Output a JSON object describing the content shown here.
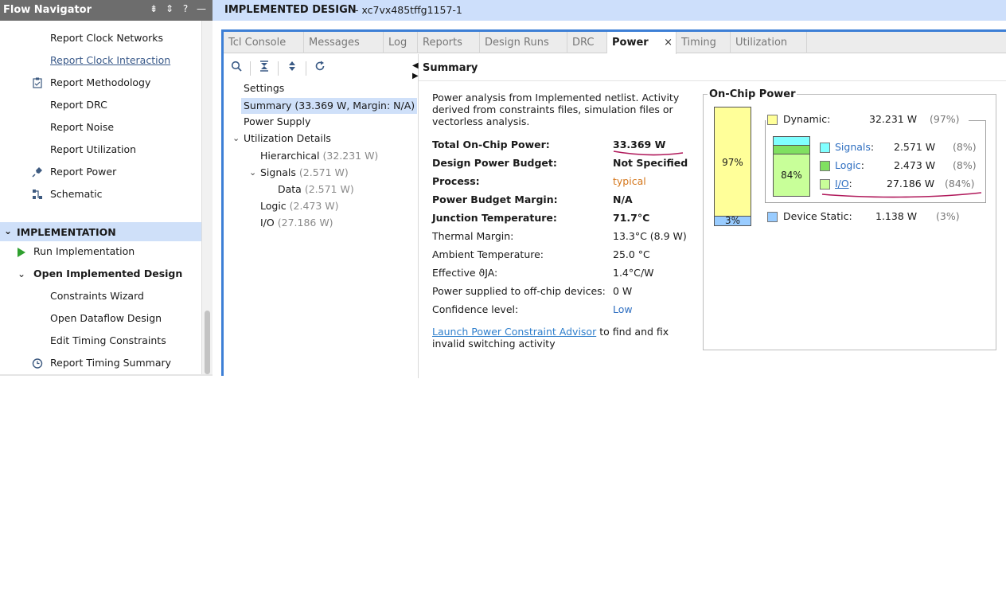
{
  "colors": {
    "header_blue": "#cddffb",
    "accent": "#3d7fd6",
    "dynamic": "#ffff99",
    "signals": "#80ffff",
    "logic": "#80e060",
    "io": "#c8ff99",
    "static": "#99ccff",
    "annotation": "#b0185a"
  },
  "nav": {
    "title": "Flow Navigator",
    "header_icons": [
      "collapse-all-icon",
      "sort-icon",
      "help-icon",
      "minimize-icon"
    ],
    "items_top": [
      {
        "label": "Report Clock Networks",
        "icon": ""
      },
      {
        "label": "Report Clock Interaction",
        "icon": "",
        "link": true
      },
      {
        "label": "Report Methodology",
        "icon": "clipboard-icon"
      },
      {
        "label": "Report DRC",
        "icon": ""
      },
      {
        "label": "Report Noise",
        "icon": ""
      },
      {
        "label": "Report Utilization",
        "icon": ""
      },
      {
        "label": "Report Power",
        "icon": "power-plug-icon"
      },
      {
        "label": "Schematic",
        "icon": "schematic-icon"
      }
    ],
    "section_label": "IMPLEMENTATION",
    "run_impl": "Run Implementation",
    "open_impl": "Open Implemented Design",
    "items_bottom": [
      {
        "label": "Constraints Wizard",
        "icon": ""
      },
      {
        "label": "Open Dataflow Design",
        "icon": ""
      },
      {
        "label": "Edit Timing Constraints",
        "icon": ""
      },
      {
        "label": "Report Timing Summary",
        "icon": "clock-icon"
      }
    ]
  },
  "header": {
    "title": "IMPLEMENTED DESIGN",
    "part": "- xc7vx485tffg1157-1"
  },
  "tabs": [
    "Tcl Console",
    "Messages",
    "Log",
    "Reports",
    "Design Runs",
    "DRC",
    "Power",
    "Timing",
    "Utilization"
  ],
  "active_tab": "Power",
  "tab_close": "×",
  "tree": {
    "settings": "Settings",
    "summary": "Summary (33.369 W, Margin: N/A)",
    "power_supply": "Power Supply",
    "utilization_details": "Utilization Details",
    "hierarchical": "Hierarchical",
    "hierarchical_val": "(32.231 W)",
    "signals": "Signals",
    "signals_val": "(2.571 W)",
    "data": "Data",
    "data_val": "(2.571 W)",
    "logic": "Logic",
    "logic_val": "(2.473 W)",
    "io": "I/O",
    "io_val": "(27.186 W)"
  },
  "summary": {
    "title": "Summary",
    "description": "Power analysis from Implemented netlist. Activity derived from constraints files, simulation files or vectorless analysis.",
    "rows": [
      {
        "key": "Total On-Chip Power:",
        "value": "33.369 W",
        "bold": true
      },
      {
        "key": "Design Power Budget:",
        "value": "Not Specified",
        "bold": true
      },
      {
        "key": "Process:",
        "value": "typical",
        "bold": true
      },
      {
        "key": "Power Budget Margin:",
        "value": "N/A",
        "bold": true
      },
      {
        "key": "Junction Temperature:",
        "value": "71.7°C",
        "bold": true
      },
      {
        "key": "Thermal Margin:",
        "value": "13.3°C (8.9 W)",
        "bold": false
      },
      {
        "key": "Ambient Temperature:",
        "value": "25.0 °C",
        "bold": false
      },
      {
        "key": "Effective ϑJA:",
        "value": "1.4°C/W",
        "bold": false
      },
      {
        "key": "Power supplied to off-chip devices:",
        "value": "0 W",
        "bold": false
      },
      {
        "key": "Confidence level:",
        "value": "Low",
        "bold": false
      }
    ],
    "advisor_link": "Launch Power Constraint Advisor",
    "advisor_rest": " to find and fix invalid switching activity"
  },
  "onchip": {
    "title": "On-Chip Power",
    "dynamic_pct_label": "97%",
    "static_pct_label": "3%",
    "io_pct_label": "84%",
    "dynamic": {
      "label": "Dynamic:",
      "value": "32.231 W",
      "pct": "(97%)"
    },
    "signals": {
      "label": "Signals",
      "value": "2.571 W",
      "pct": "(8%)"
    },
    "logic": {
      "label": "Logic",
      "value": "2.473 W",
      "pct": "(8%)"
    },
    "io": {
      "label": "I/O",
      "value": "27.186 W",
      "pct": "(84%)"
    },
    "static": {
      "label": "Device Static:",
      "value": "1.138 W",
      "pct": "(3%)"
    }
  }
}
